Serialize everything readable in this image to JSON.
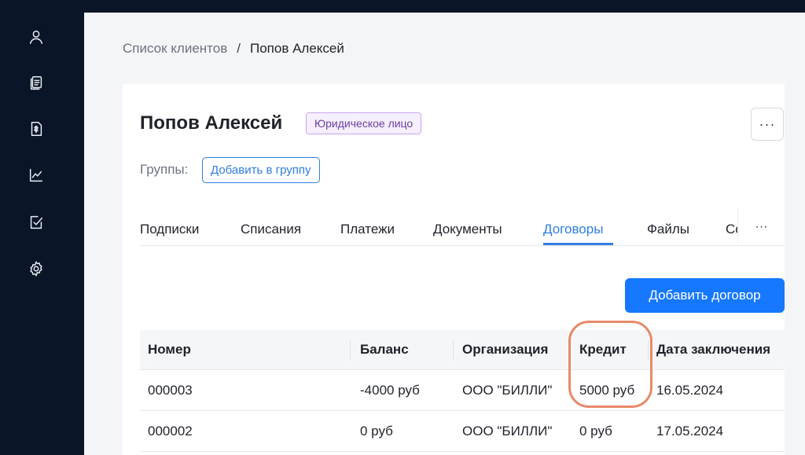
{
  "sidebar": {
    "items": [
      {
        "icon": "user-icon"
      },
      {
        "icon": "documents-icon"
      },
      {
        "icon": "invoice-icon"
      },
      {
        "icon": "chart-icon"
      },
      {
        "icon": "checklist-icon"
      },
      {
        "icon": "gear-icon"
      }
    ]
  },
  "breadcrumb": {
    "parent": "Список клиентов",
    "separator": "/",
    "current": "Попов Алексей"
  },
  "client": {
    "name": "Попов Алексей",
    "type_badge": "Юридическое лицо",
    "more": "···"
  },
  "groups": {
    "label": "Группы:",
    "add_button": "Добавить в группу"
  },
  "tabs": {
    "items": [
      "Подписки",
      "Списания",
      "Платежи",
      "Документы",
      "Договоры",
      "Файлы",
      "Со"
    ],
    "active": "Договоры",
    "more": "···"
  },
  "contracts": {
    "add_button": "Добавить договор",
    "columns": [
      "Номер",
      "Баланс",
      "Организация",
      "Кредит",
      "Дата заключения"
    ],
    "rows": [
      [
        "000003",
        "-4000 руб",
        "ООО \"БИЛЛИ\"",
        "5000 руб",
        "16.05.2024"
      ],
      [
        "000002",
        "0 руб",
        "ООО \"БИЛЛИ\"",
        "0 руб",
        "17.05.2024"
      ]
    ]
  },
  "colors": {
    "sidebar_bg": "#0b1528",
    "accent": "#1677ff",
    "badge_border": "#c9a6f0",
    "highlight": "#e8896a"
  }
}
